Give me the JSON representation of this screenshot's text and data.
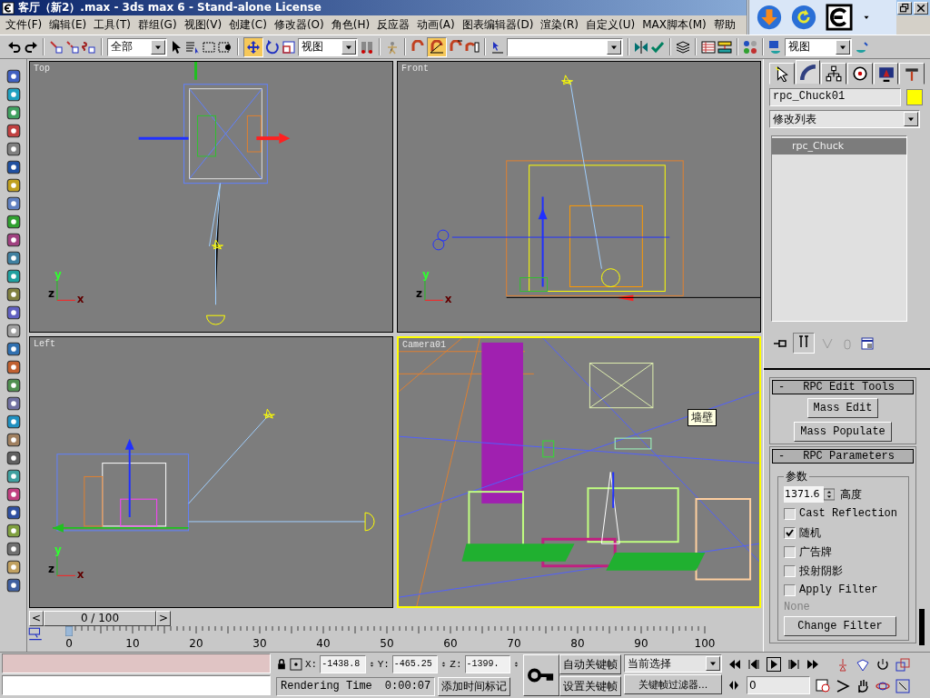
{
  "window": {
    "title": "客厅（新2）.max - 3ds max 6 - Stand-alone License"
  },
  "menu": [
    "文件(F)",
    "编辑(E)",
    "工具(T)",
    "群组(G)",
    "视图(V)",
    "创建(C)",
    "修改器(O)",
    "角色(H)",
    "反应器",
    "动画(A)",
    "图表编辑器(D)",
    "渲染(R)",
    "自定义(U)",
    "MAX脚本(M)",
    "帮助"
  ],
  "toolbar": {
    "selection_filter": "全部",
    "reference_coord": "视图",
    "render_type": "视图",
    "move_tool_on": true,
    "angle_snap_on": true
  },
  "viewports": [
    {
      "label": "Top",
      "kind": "top",
      "active": false,
      "axes": [
        "y",
        "z",
        "x"
      ]
    },
    {
      "label": "Front",
      "kind": "front",
      "active": false,
      "axes": [
        "y",
        "z",
        "x"
      ]
    },
    {
      "label": "Left",
      "kind": "left",
      "active": false,
      "axes": [
        "y",
        "z",
        "x"
      ]
    },
    {
      "label": "Camera01",
      "kind": "camera",
      "active": true,
      "tooltip": "墙壁"
    }
  ],
  "command_panel": {
    "tabs": [
      {
        "selected": false
      },
      {
        "selected": true
      },
      {
        "selected": false
      },
      {
        "selected": false
      },
      {
        "selected": false
      },
      {
        "selected": false
      }
    ],
    "object_name": "rpc_Chuck01",
    "object_swatch": {
      "color": "#ffff00"
    },
    "modifier_list": "修改列表",
    "stack": [
      {
        "label": "rpc_Chuck",
        "selected": true
      }
    ],
    "edit_tools": {
      "sign": "-",
      "title": "RPC Edit Tools",
      "buttons": [
        "Mass Edit",
        "Mass Populate"
      ]
    },
    "parameters": {
      "sign": "-",
      "title": "RPC Parameters",
      "group": "参数",
      "spinner_value": "1371.6",
      "spinner_label": "高度",
      "checkboxes": [
        {
          "label": "Cast Reflection",
          "checked": false
        },
        {
          "label": "随机",
          "checked": true
        },
        {
          "label": "广告牌",
          "checked": false
        },
        {
          "label": "投射阴影",
          "checked": false
        },
        {
          "label": "Apply Filter",
          "checked": false
        }
      ],
      "filter_name": "None",
      "filter_button": "Change Filter"
    }
  },
  "time_slider": {
    "prev": "<",
    "position": "0 / 100",
    "next": ">"
  },
  "track_bar": {
    "ticks": [
      "0",
      "10",
      "20",
      "30",
      "40",
      "50",
      "60",
      "70",
      "80",
      "90",
      "100"
    ]
  },
  "status": {
    "coords": [
      {
        "axis": "X:",
        "value": "-1438.8"
      },
      {
        "axis": "Y:",
        "value": "-465.25"
      },
      {
        "axis": "Z:",
        "value": "-1399."
      }
    ],
    "rendering_label": "Rendering Time",
    "rendering_value": "0:00:07",
    "add_time_tag": "添加时间标记",
    "auto_key": "自动关键帧",
    "set_key": "设置关键帧",
    "key_select": "当前选择",
    "key_filters": "关键帧过滤器...",
    "current_frame": "0"
  }
}
